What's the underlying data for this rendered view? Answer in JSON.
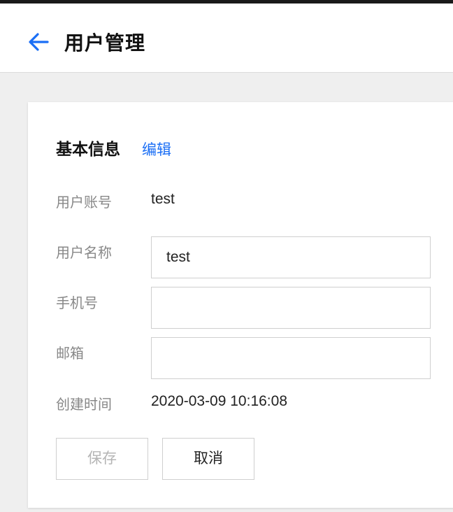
{
  "header": {
    "back_icon": "arrow-left-icon",
    "title": "用户管理",
    "accent_color": "#1a6ef5"
  },
  "card": {
    "section_title": "基本信息",
    "edit_label": "编辑",
    "fields": {
      "account": {
        "label": "用户账号",
        "value": "test"
      },
      "name": {
        "label": "用户名称",
        "value": "test"
      },
      "phone": {
        "label": "手机号",
        "value": ""
      },
      "email": {
        "label": "邮箱",
        "value": ""
      },
      "created": {
        "label": "创建时间",
        "value": "2020-03-09 10:16:08"
      }
    },
    "buttons": {
      "save_label": "保存",
      "save_disabled": true,
      "cancel_label": "取消"
    }
  }
}
